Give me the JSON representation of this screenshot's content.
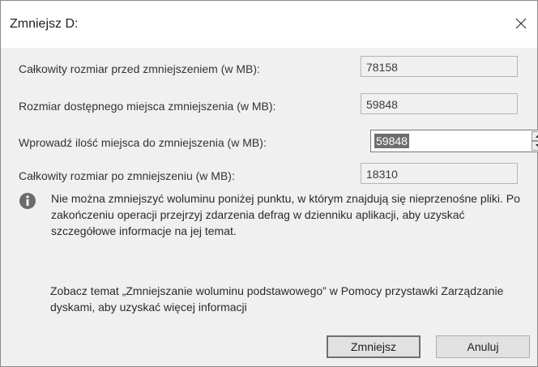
{
  "dialog": {
    "title": "Zmniejsz D:"
  },
  "fields": {
    "total_before_label": "Całkowity rozmiar przed zmniejszeniem (w MB):",
    "total_before_value": "78158",
    "available_label": "Rozmiar dostępnego miejsca zmniejszenia (w MB):",
    "available_value": "59848",
    "enter_label": "Wprowadź ilość miejsca do zmniejszenia (w MB):",
    "enter_value": "59848",
    "total_after_label": "Całkowity rozmiar po zmniejszeniu (w MB):",
    "total_after_value": "18310"
  },
  "info": {
    "icon": "info-icon",
    "text": "Nie można zmniejszyć woluminu poniżej punktu, w którym znajdują się nieprzenośne pliki. Po zakończeniu operacji przejrzyj zdarzenia defrag w dzienniku aplikacji, aby uzyskać szczegółowe informacje na jej temat."
  },
  "help": {
    "text": "Zobacz temat „Zmniejszanie woluminu podstawowego” w Pomocy przystawki Zarządzanie dyskami, aby uzyskać więcej informacji"
  },
  "buttons": {
    "primary": "Zmniejsz",
    "cancel": "Anuluj"
  },
  "colors": {
    "dialog_bg": "#f0f0f0",
    "titlebar_bg": "#ffffff",
    "selection_bg": "#6f6f6f"
  }
}
